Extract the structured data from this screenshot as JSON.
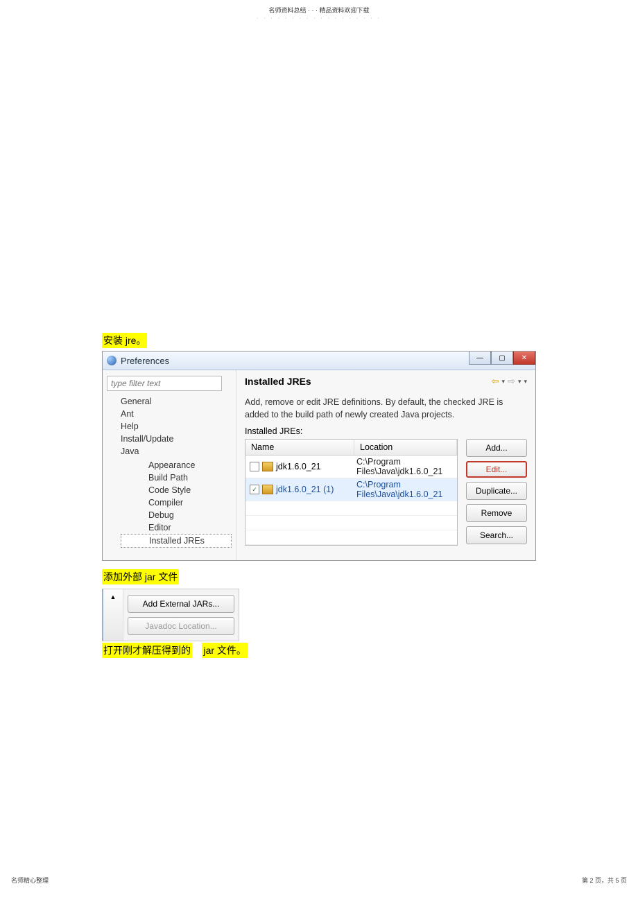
{
  "header": {
    "t1": "名师资料总结",
    "sep": "·  ·  ·",
    "t2": "精品资料欢迎下载",
    "dots": "· · · · · · · · · · · · · · · · · ·"
  },
  "labels": {
    "l1": "安装  jre。",
    "l2": "添加外部   jar 文件",
    "l3a": "打开刚才解压得到的",
    "l3b": "jar 文件。"
  },
  "dlg": {
    "title": "Preferences",
    "filter": "type filter text",
    "tree": {
      "items": [
        "General",
        "Ant",
        "Help",
        "Install/Update",
        "Java"
      ],
      "sub": [
        "Appearance",
        "Build Path",
        "Code Style",
        "Compiler",
        "Debug",
        "Editor",
        "Installed JREs"
      ]
    },
    "main": {
      "title": "Installed JREs",
      "desc": "Add, remove or edit JRE definitions. By default, the checked JRE is added to the build path of newly created Java projects.",
      "sub": "Installed JREs:",
      "cols": {
        "c1": "Name",
        "c2": "Location"
      },
      "rows": [
        {
          "checked": false,
          "name": "jdk1.6.0_21",
          "loc": "C:\\Program Files\\Java\\jdk1.6.0_21"
        },
        {
          "checked": true,
          "name": "jdk1.6.0_21 (1)",
          "loc": "C:\\Program Files\\Java\\jdk1.6.0_21"
        }
      ],
      "btns": {
        "add": "Add...",
        "edit": "Edit...",
        "dup": "Duplicate...",
        "rem": "Remove",
        "srch": "Search..."
      }
    }
  },
  "frag": {
    "b1": "Add External JARs...",
    "b2": "Javadoc Location..."
  },
  "footer": {
    "l": "名师精心整理",
    "r": "第 2 页，共 5 页",
    "dots": "· · · · · · ·"
  }
}
